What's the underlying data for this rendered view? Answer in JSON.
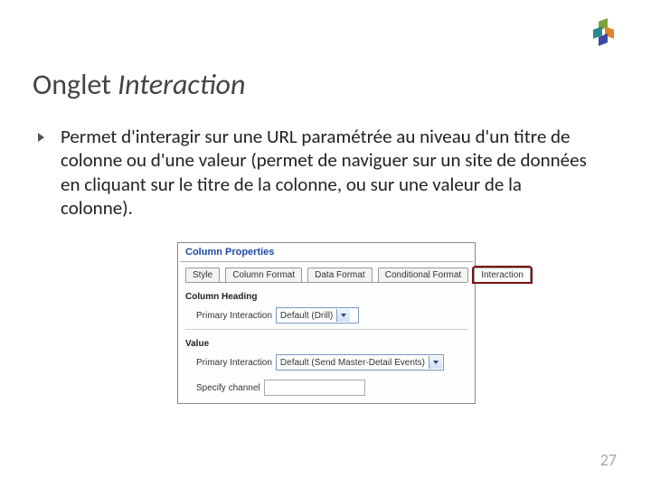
{
  "title_plain": "Onglet ",
  "title_italic": "Interaction",
  "bullet": "Permet d'interagir sur une URL paramétrée au niveau d'un titre de colonne ou d'une valeur (permet de naviguer sur un site de données en cliquant sur le titre de la colonne, ou sur une valeur de la colonne).",
  "panel": {
    "header": "Column Properties",
    "tabs": {
      "style": "Style",
      "column_format": "Column Format",
      "data_format": "Data Format",
      "conditional_format": "Conditional Format",
      "interaction": "Interaction"
    },
    "heading_section": "Column Heading",
    "heading_field_label": "Primary Interaction",
    "heading_field_value": "Default (Drill)",
    "value_section": "Value",
    "value_field_label": "Primary Interaction",
    "value_field_value": "Default (Send Master-Detail Events)",
    "channel_label": "Specify channel"
  },
  "page_number": "27"
}
